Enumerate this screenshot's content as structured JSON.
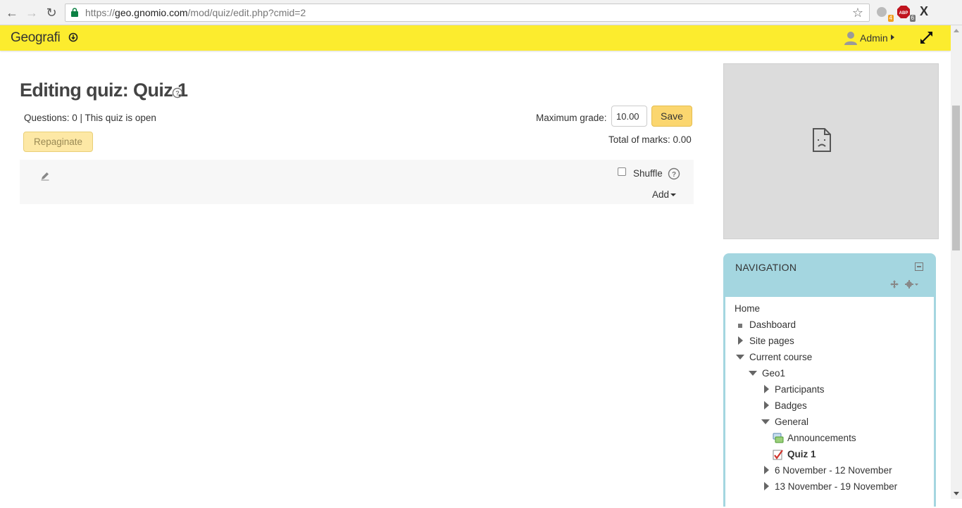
{
  "browser": {
    "url_scheme": "https://",
    "url_host": "geo.gnomio.com",
    "url_path": "/mod/quiz/edit.php?cmid=2",
    "ext_badge_1": "4",
    "ext_badge_2": "6",
    "ext_label_3": "X"
  },
  "header": {
    "brand": "Geografi",
    "user_name": "Admin",
    "bar_color": "#fcec2e"
  },
  "main": {
    "page_title": "Editing quiz: Quiz 1",
    "status": "Questions: 0 | This quiz is open",
    "repaginate_label": "Repaginate",
    "max_grade_label": "Maximum grade:",
    "max_grade_value": "10.00",
    "save_label": "Save",
    "total_marks": "Total of marks: 0.00",
    "shuffle_label": "Shuffle",
    "shuffle_checked": false,
    "add_label": "Add"
  },
  "navigation": {
    "title": "NAVIGATION",
    "items": {
      "home": "Home",
      "dashboard": "Dashboard",
      "site_pages": "Site pages",
      "current_course": "Current course",
      "geo1": "Geo1",
      "participants": "Participants",
      "badges": "Badges",
      "general": "General",
      "announcements": "Announcements",
      "quiz1": "Quiz 1",
      "week1": "6 November - 12 November",
      "week2": "13 November - 19 November"
    },
    "block_color": "#a4d6e0"
  }
}
